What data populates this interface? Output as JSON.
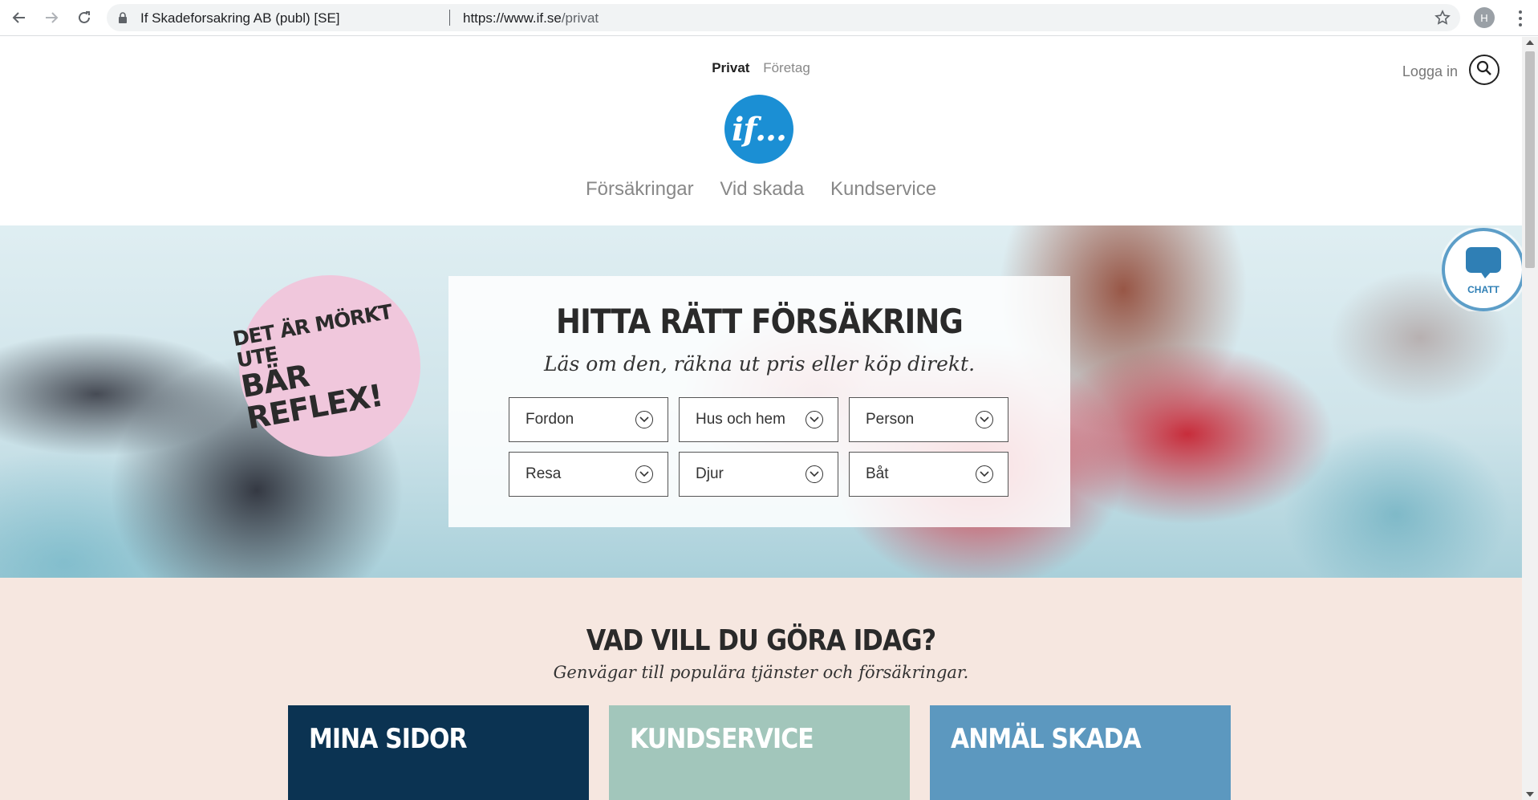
{
  "browser": {
    "site_name": "If Skadeforsakring AB (publ) [SE]",
    "url_host": "https://www.if.se",
    "url_path": "/privat",
    "profile_initial": "H"
  },
  "header": {
    "segment_active": "Privat",
    "segment_other": "Företag",
    "login": "Logga in",
    "logo_text": "if...",
    "nav": [
      "Försäkringar",
      "Vid skada",
      "Kundservice"
    ]
  },
  "hero": {
    "badge_line1": "Det är mörkt ute",
    "badge_line2": "Bär reflex!",
    "title": "HITTA RÄTT FÖRSÄKRING",
    "tagline": "Läs om den, räkna ut pris eller köp direkt.",
    "categories": [
      "Fordon",
      "Hus och hem",
      "Person",
      "Resa",
      "Djur",
      "Båt"
    ],
    "chat_label": "CHATT"
  },
  "shortcuts": {
    "title": "VAD VILL DU GÖRA IDAG?",
    "subtitle": "Genvägar till populära tjänster och försäkringar.",
    "tiles": [
      "MINA SIDOR",
      "KUNDSERVICE",
      "ANMÄL SKADA"
    ]
  },
  "colors": {
    "brand_blue": "#1b8fd4",
    "navy_tile": "#0b3352",
    "mint_tile": "#a2c6bb",
    "blue_tile": "#5c98bf",
    "reflex_pink": "#f0c7dc",
    "lower_bg": "#f6e7e0"
  }
}
